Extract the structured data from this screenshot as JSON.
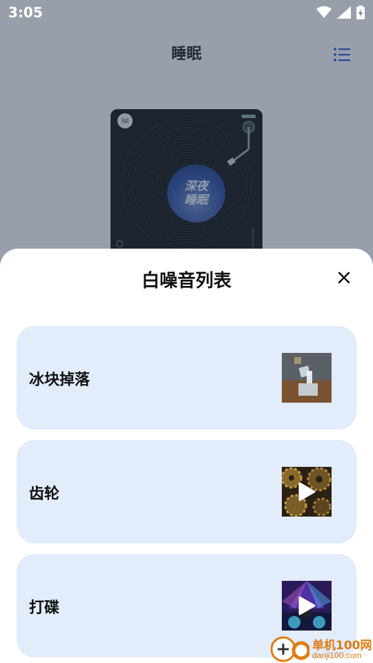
{
  "status_bar": {
    "time": "3:05"
  },
  "header": {
    "title": "睡眠",
    "menu_icon": "list-icon"
  },
  "player": {
    "logo_text": "ísl",
    "record_label": "深夜\n睡眠"
  },
  "sheet": {
    "title": "白噪音列表",
    "close_icon": "close-icon",
    "items": [
      {
        "label": "冰块掉落",
        "thumb": "ice-cubes",
        "playing": false
      },
      {
        "label": "齿轮",
        "thumb": "gears",
        "playing": true
      },
      {
        "label": "打碟",
        "thumb": "dj-stage",
        "playing": true
      }
    ]
  },
  "watermark": {
    "brand": "单机100网",
    "url": "danji100.com"
  },
  "colors": {
    "item_bg": "#e2ecfb",
    "accent": "#3a5bd9",
    "watermark": "#e07b12"
  }
}
